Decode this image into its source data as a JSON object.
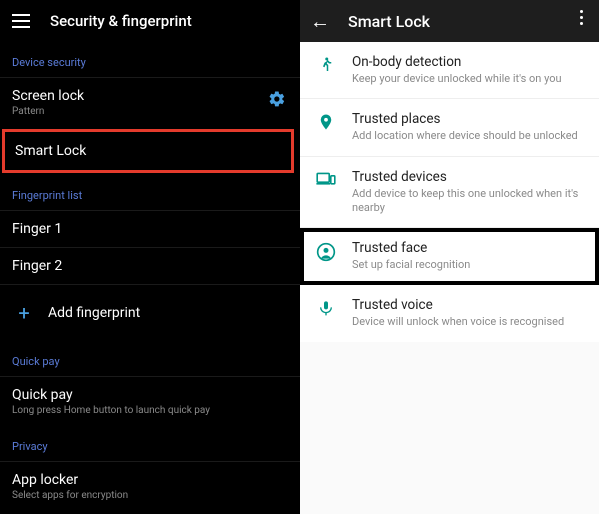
{
  "left": {
    "header_title": "Security & fingerprint",
    "sections": {
      "device_security": "Device security",
      "fingerprint_list": "Fingerprint list",
      "quick_pay": "Quick pay",
      "privacy": "Privacy"
    },
    "screen_lock": {
      "title": "Screen lock",
      "sub": "Pattern"
    },
    "smart_lock": {
      "title": "Smart Lock"
    },
    "fingers": [
      "Finger 1",
      "Finger 2"
    ],
    "add_fp": "Add fingerprint",
    "quick_pay_item": {
      "title": "Quick pay",
      "sub": "Long press Home button to launch quick pay"
    },
    "app_locker": {
      "title": "App locker",
      "sub": "Select apps for encryption"
    }
  },
  "right": {
    "header_title": "Smart Lock",
    "items": [
      {
        "title": "On-body detection",
        "sub": "Keep your device unlocked while it's on you"
      },
      {
        "title": "Trusted places",
        "sub": "Add location where device should be unlocked"
      },
      {
        "title": "Trusted devices",
        "sub": "Add device to keep this one unlocked when it's nearby"
      },
      {
        "title": "Trusted face",
        "sub": "Set up facial recognition"
      },
      {
        "title": "Trusted voice",
        "sub": "Device will unlock when voice is recognised"
      }
    ]
  }
}
